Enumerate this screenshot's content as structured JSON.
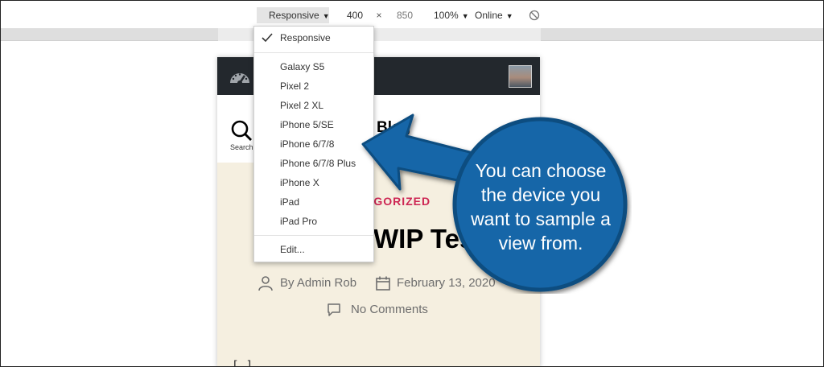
{
  "toolbar": {
    "device_select": "Responsive",
    "width": "400",
    "dimension_separator": "×",
    "height": "850",
    "zoom": "100%",
    "network": "Online",
    "rotate_icon": "rotate-disabled-icon"
  },
  "device_menu": {
    "selected": "Responsive",
    "items": [
      "Galaxy S5",
      "Pixel 2",
      "Pixel 2 XL",
      "iPhone 5/SE",
      "iPhone 6/7/8",
      "iPhone 6/7/8 Plus",
      "iPhone X",
      "iPad",
      "iPad Pro"
    ],
    "edit": "Edit..."
  },
  "site": {
    "search_label": "Search",
    "title_fragment": "Blog",
    "category": "EGORIZED",
    "post_title": "WIP Tes",
    "author": "By Admin Rob",
    "date": "February 13, 2020",
    "comments": "No Comments",
    "content_snippet": "[...]"
  },
  "callout": {
    "line1": "You can choose",
    "line2": "the device you",
    "line3": "want to sample a",
    "line4": "view from.",
    "color": "#1466a8"
  },
  "colors": {
    "admin_bar": "#23282d",
    "accent": "#cd2653",
    "content_bg": "#f5efe0"
  }
}
